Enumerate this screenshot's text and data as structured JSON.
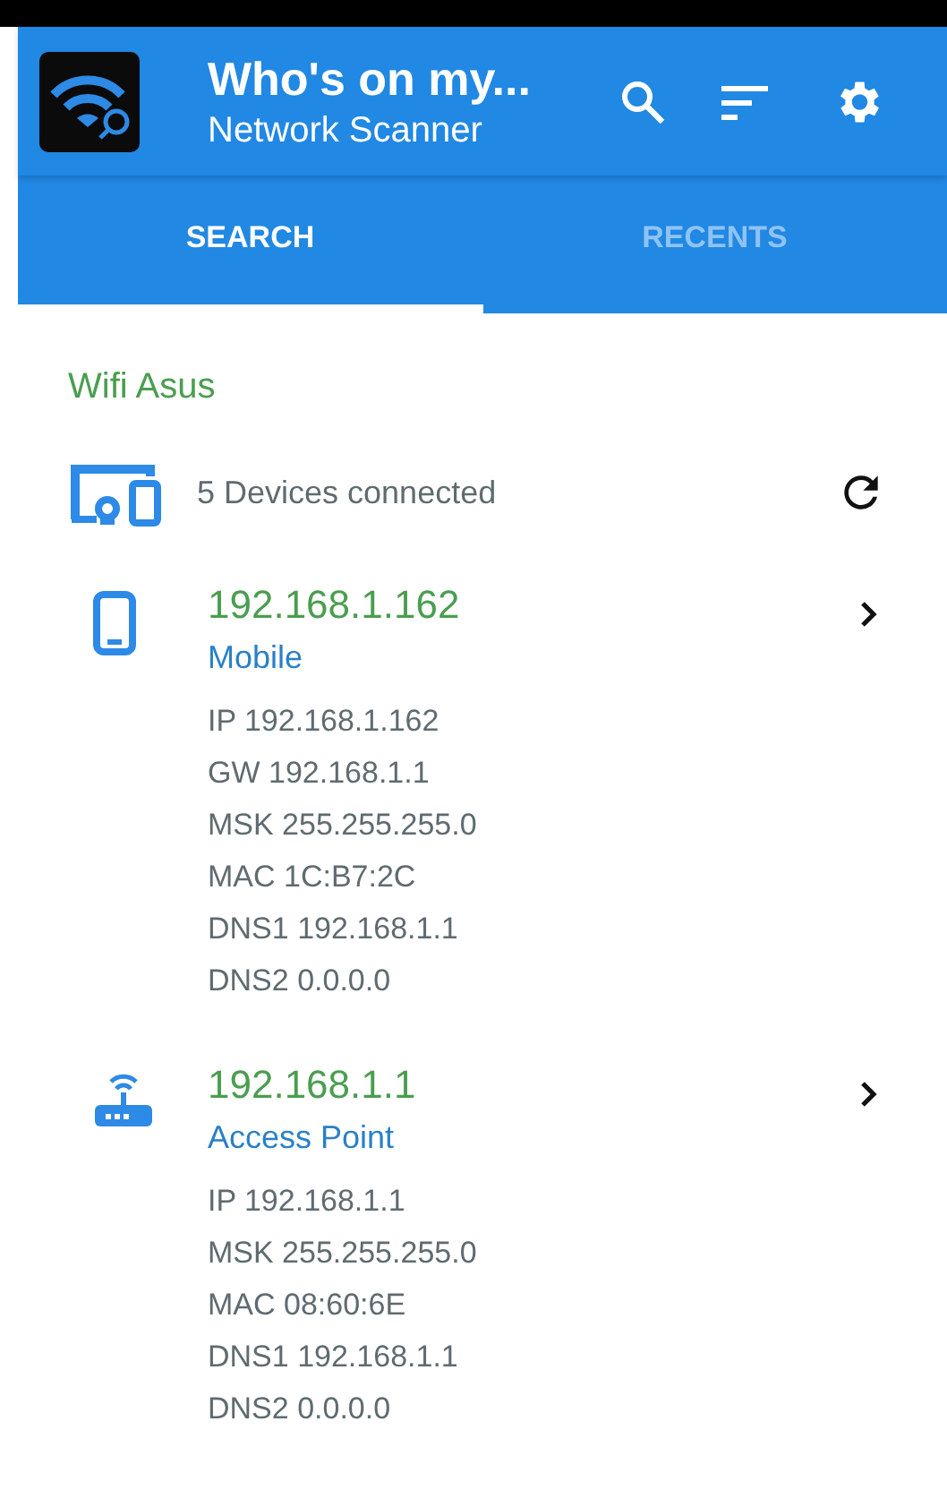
{
  "app_bar": {
    "title": "Who's on my...",
    "subtitle": "Network Scanner"
  },
  "tabs": [
    {
      "label": "SEARCH",
      "selected": true
    },
    {
      "label": "RECENTS",
      "selected": false
    }
  ],
  "network": {
    "name": "Wifi Asus",
    "summary": "5 Devices connected"
  },
  "devices": [
    {
      "kind": "mobile",
      "address": "192.168.1.162",
      "type": "Mobile",
      "details": [
        "IP 192.168.1.162",
        "GW 192.168.1.1",
        "MSK 255.255.255.0",
        "MAC 1C:B7:2C",
        "DNS1 192.168.1.1",
        "DNS2 0.0.0.0"
      ]
    },
    {
      "kind": "router",
      "address": "192.168.1.1",
      "type": "Access Point",
      "details": [
        "IP 192.168.1.1",
        "MSK 255.255.255.0",
        "MAC 08:60:6E",
        "DNS1 192.168.1.1",
        "DNS2 0.0.0.0"
      ]
    }
  ]
}
